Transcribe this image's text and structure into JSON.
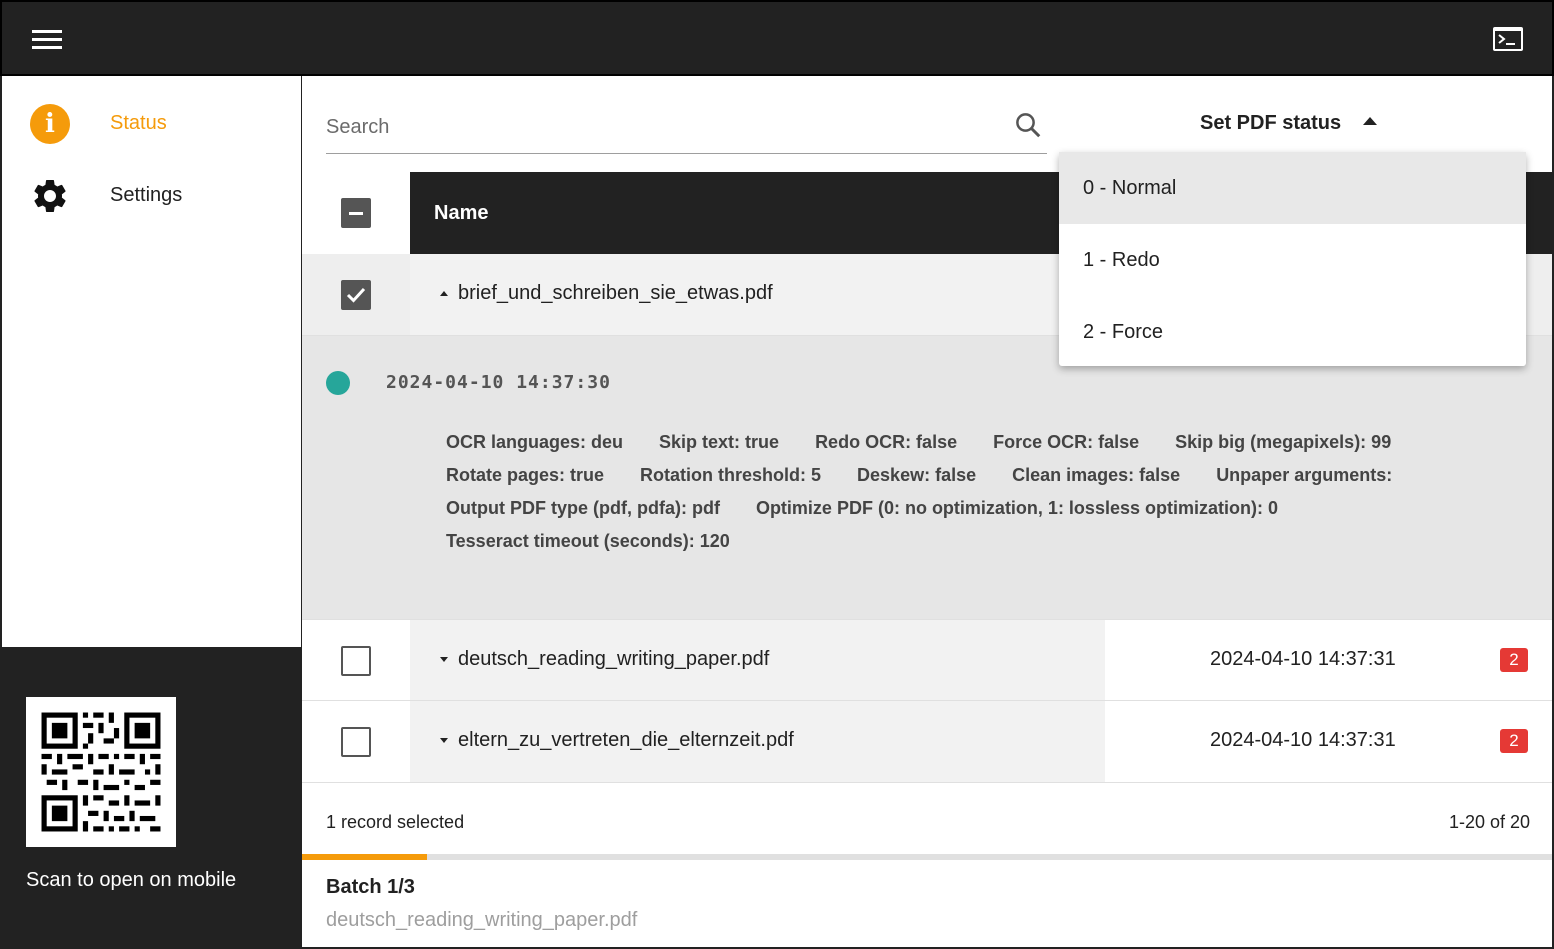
{
  "topbar": {
    "menu_icon": "hamburger-icon",
    "terminal_icon": "terminal-icon"
  },
  "sidebar": {
    "items": [
      {
        "label": "Status",
        "icon": "info-icon",
        "active": true,
        "color": "#f59b0b"
      },
      {
        "label": "Settings",
        "icon": "gear-icon",
        "active": false
      }
    ],
    "qr_caption": "Scan to open on mobile"
  },
  "search": {
    "placeholder": "Search",
    "value": ""
  },
  "pdf_status": {
    "label": "Set PDF status",
    "options": [
      "0 - Normal",
      "1 - Redo",
      "2 - Force"
    ],
    "highlighted": "0 - Normal"
  },
  "table": {
    "header": {
      "name": "Name"
    },
    "rows": [
      {
        "name": "brief_und_schreiben_sie_etwas.pdf",
        "checked": true,
        "expanded": true,
        "detail": {
          "time": "2024-04-10 14:37:30",
          "params": [
            "OCR languages: deu",
            "Skip text: true",
            "Redo OCR: false",
            "Force OCR: false",
            "Skip big (megapixels): 99",
            "Rotate pages: true",
            "Rotation threshold: 5",
            "Deskew: false",
            "Clean images: false",
            "Unpaper arguments:",
            "Output PDF type (pdf, pdfa): pdf",
            "Optimize PDF (0: no optimization, 1: lossless optimization): 0",
            "Tesseract timeout (seconds): 120"
          ]
        }
      },
      {
        "name": "deutsch_reading_writing_paper.pdf",
        "checked": false,
        "expanded": false,
        "date": "2024-04-10 14:37:31",
        "badge": "2"
      },
      {
        "name": "eltern_zu_vertreten_die_elternzeit.pdf",
        "checked": false,
        "expanded": false,
        "date": "2024-04-10 14:37:31",
        "badge": "2"
      }
    ],
    "selection_text": "1 record selected",
    "pagination": "1-20 of 20"
  },
  "batch": {
    "title": "Batch 1/3",
    "file": "deutsch_reading_writing_paper.pdf",
    "progress": 0.1,
    "color": "#f59b0b"
  }
}
